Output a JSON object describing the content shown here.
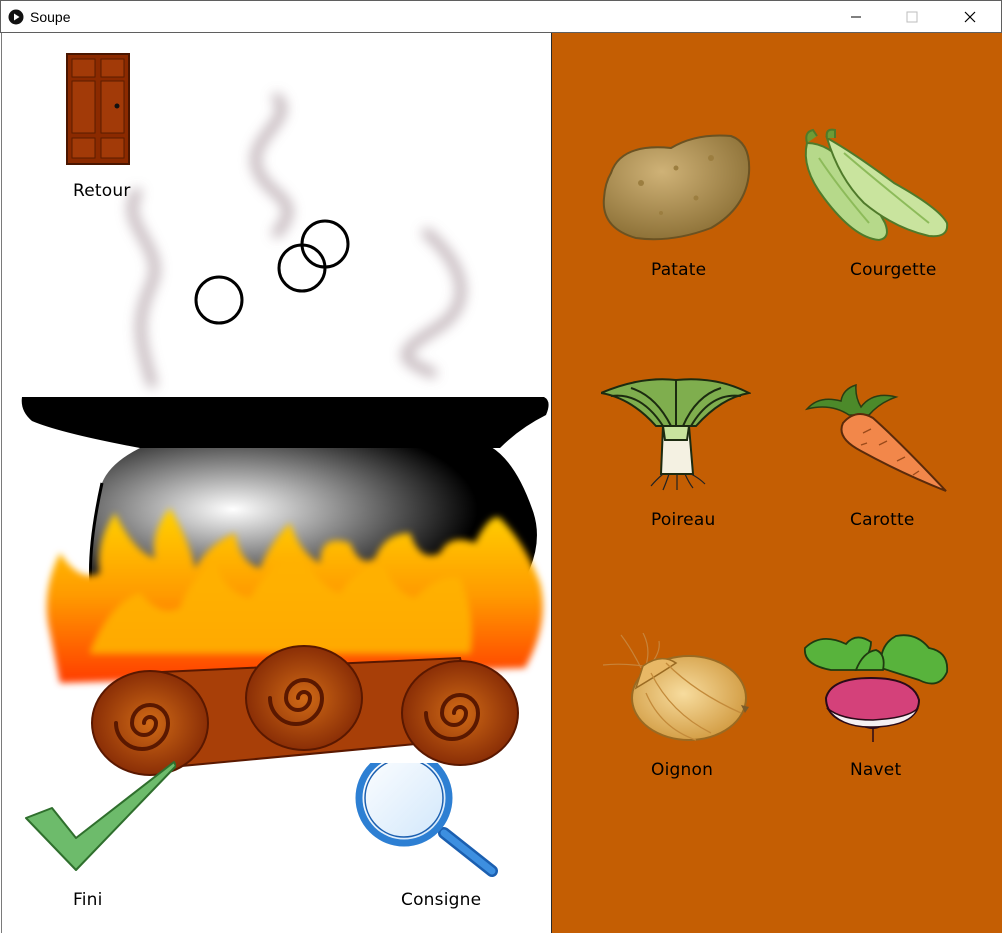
{
  "window": {
    "title": "Soupe",
    "controls": [
      "minimize",
      "maximize",
      "close"
    ]
  },
  "left": {
    "back_label": "Retour",
    "done_label": "Fini",
    "instructions_label": "Consigne"
  },
  "ingredients": [
    {
      "name": "Patate",
      "icon": "potato-icon"
    },
    {
      "name": "Courgette",
      "icon": "zucchini-icon"
    },
    {
      "name": "Poireau",
      "icon": "leek-icon"
    },
    {
      "name": "Carotte",
      "icon": "carrot-icon"
    },
    {
      "name": "Oignon",
      "icon": "onion-icon"
    },
    {
      "name": "Navet",
      "icon": "turnip-icon"
    }
  ],
  "colors": {
    "right_panel": "#c45e03",
    "door": "#8b2a00",
    "check": "#6dbb6b",
    "magnifier": "#2d7fd3"
  }
}
